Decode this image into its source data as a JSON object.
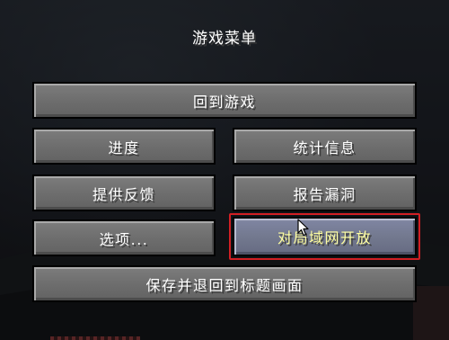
{
  "menu": {
    "title": "游戏菜单",
    "buttons": {
      "back_to_game": "回到游戏",
      "advancements": "进度",
      "statistics": "统计信息",
      "give_feedback": "提供反馈",
      "report_bugs": "报告漏洞",
      "options": "选项...",
      "open_to_lan": "对局域网开放",
      "save_and_quit": "保存并退回到标题画面"
    }
  },
  "colors": {
    "button_face": "#6f6f6f",
    "button_border": "#000000",
    "hover_face": "#7e84a0",
    "hover_text": "#ffffa0",
    "highlight_frame": "#d21f24",
    "title_text": "#ffffff"
  },
  "icons": {
    "cursor": "arrow-cursor-icon"
  }
}
